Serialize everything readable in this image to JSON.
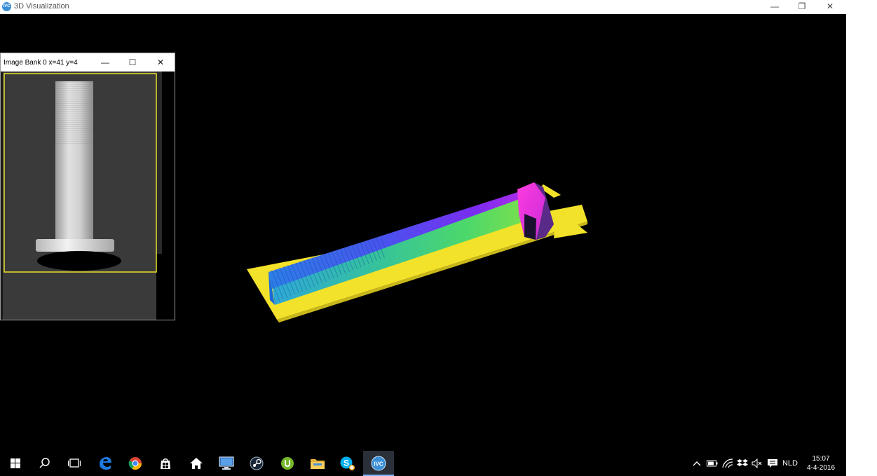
{
  "window": {
    "title": "3D Visualization",
    "app_icon_text": "IVC",
    "controls": {
      "minimize": "—",
      "restore": "❐",
      "close": "✕"
    }
  },
  "image_bank": {
    "title": "Image Bank 0 x=41 y=4",
    "controls": {
      "minimize": "—",
      "maximize": "☐",
      "close": "✕"
    }
  },
  "taskbar": {
    "items": [
      {
        "name": "start-button",
        "icon": "windows-logo"
      },
      {
        "name": "search-button",
        "icon": "search-icon"
      },
      {
        "name": "task-view-button",
        "icon": "task-view-icon"
      },
      {
        "name": "edge-button",
        "icon": "edge-icon"
      },
      {
        "name": "chrome-button",
        "icon": "chrome-icon"
      },
      {
        "name": "store-button",
        "icon": "store-icon"
      },
      {
        "name": "home-button",
        "icon": "home-icon"
      },
      {
        "name": "remote-desktop-button",
        "icon": "monitor-icon"
      },
      {
        "name": "steam-button",
        "icon": "steam-icon"
      },
      {
        "name": "utorrent-button",
        "icon": "utorrent-icon"
      },
      {
        "name": "file-explorer-button",
        "icon": "folder-icon"
      },
      {
        "name": "skype-button",
        "icon": "skype-icon"
      },
      {
        "name": "ivc-button",
        "icon": "ivc-icon",
        "label": "IVC",
        "active": true
      }
    ],
    "tray": {
      "language": "NLD",
      "time": "15:07",
      "date": "4-4-2016"
    }
  }
}
